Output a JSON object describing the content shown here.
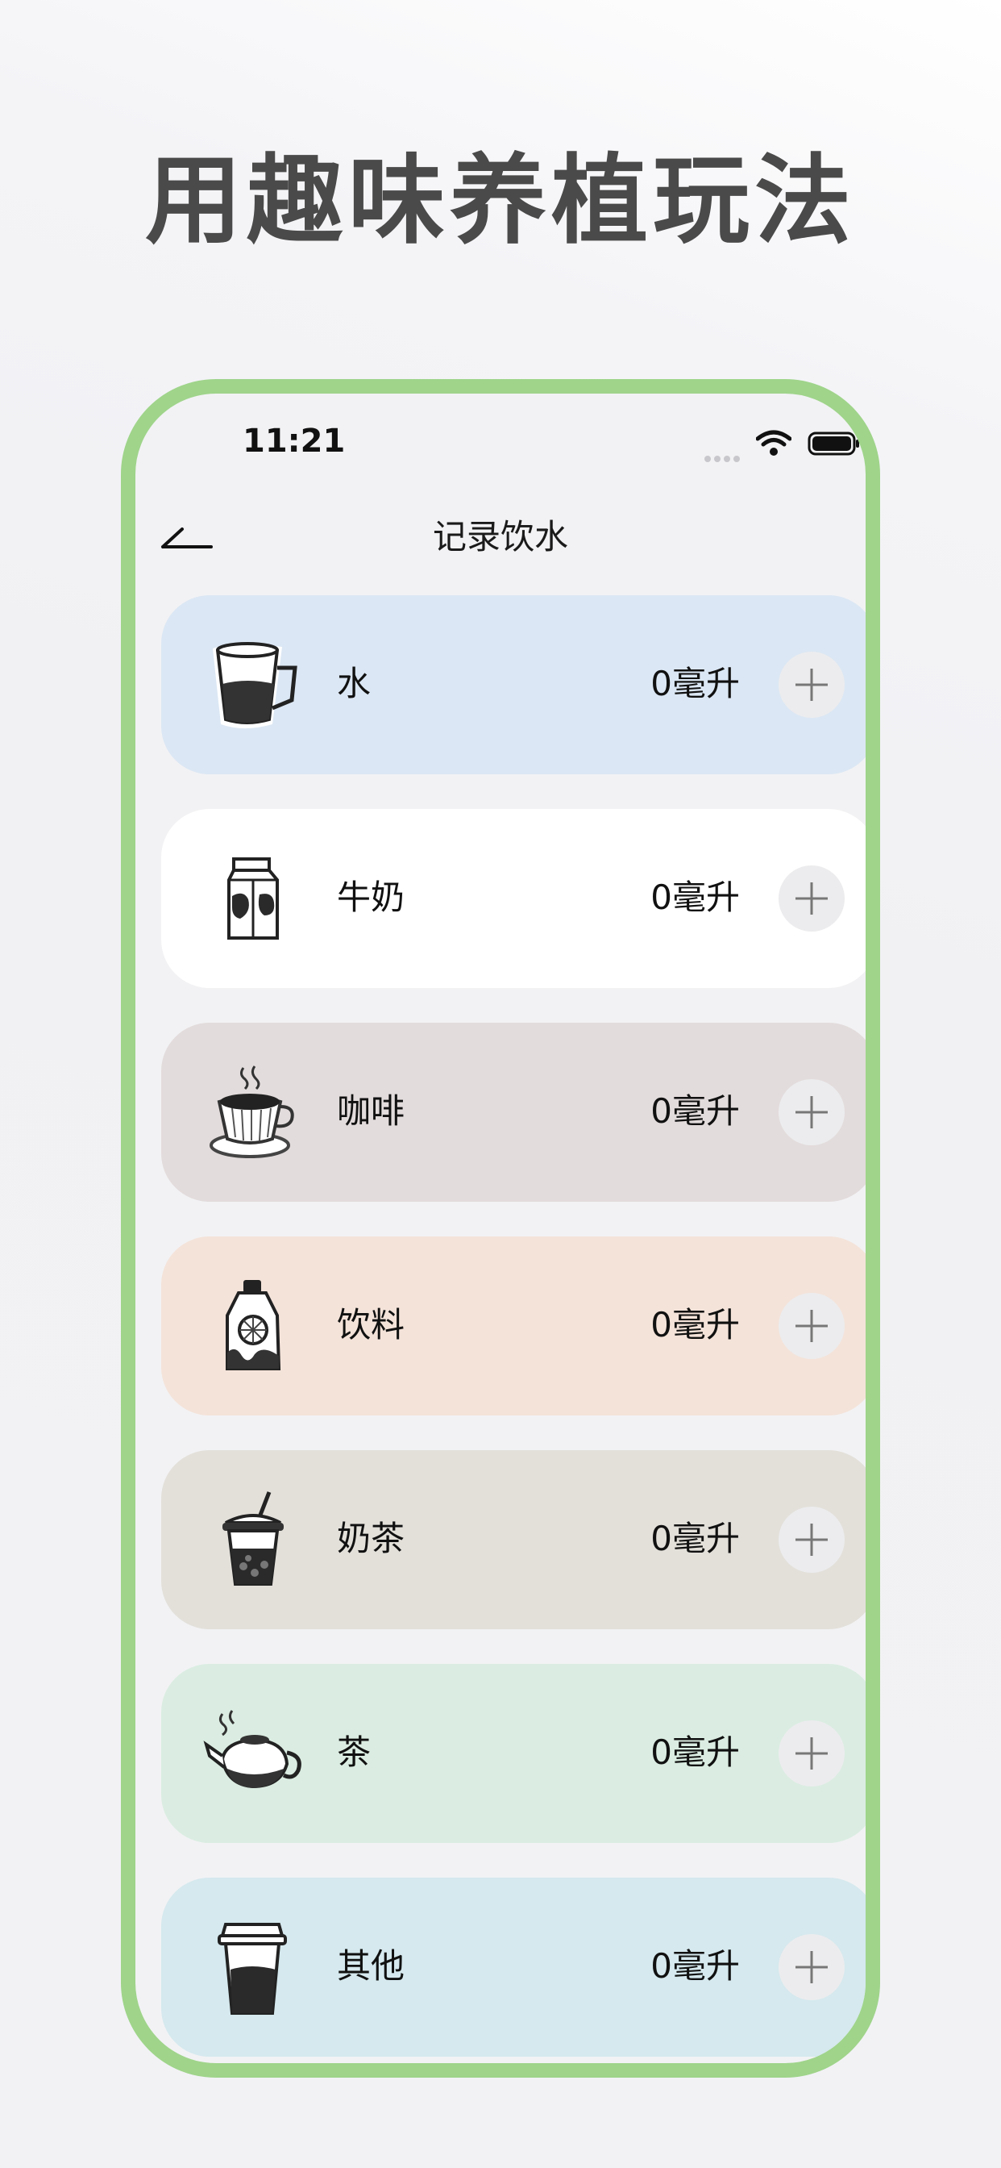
{
  "headline": "用趣味养植玩法",
  "status_bar": {
    "time": "11:21"
  },
  "nav": {
    "title": "记录饮水"
  },
  "drinks": [
    {
      "name": "水",
      "amount": "0毫升",
      "bg": "#dbe7f4",
      "icon": "water-glass-icon"
    },
    {
      "name": "牛奶",
      "amount": "0毫升",
      "bg": "#ffffff",
      "icon": "milk-carton-icon"
    },
    {
      "name": "咖啡",
      "amount": "0毫升",
      "bg": "#e3dcdc",
      "icon": "coffee-cup-icon"
    },
    {
      "name": "饮料",
      "amount": "0毫升",
      "bg": "#f4e3d9",
      "icon": "drink-bottle-icon"
    },
    {
      "name": "奶茶",
      "amount": "0毫升",
      "bg": "#e3e0da",
      "icon": "bubble-tea-icon"
    },
    {
      "name": "茶",
      "amount": "0毫升",
      "bg": "#dbede2",
      "icon": "teapot-icon"
    },
    {
      "name": "其他",
      "amount": "0毫升",
      "bg": "#d5e9ee",
      "icon": "takeaway-cup-icon"
    }
  ],
  "colors": {
    "phone_frame": "#9fd48a",
    "headline": "#4a4a4a"
  }
}
